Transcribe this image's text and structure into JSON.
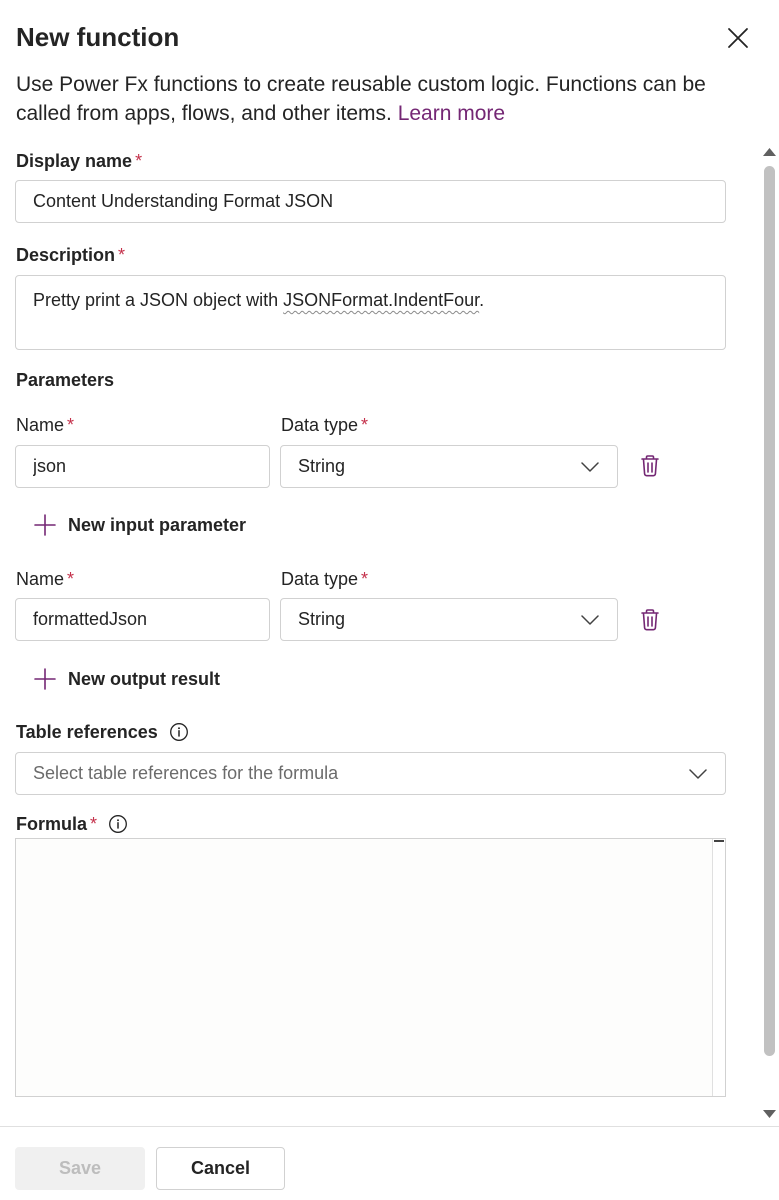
{
  "panel": {
    "title": "New function",
    "close_label": "Close",
    "intro_text": "Use Power Fx functions to create reusable custom logic. Functions can be called from apps, flows, and other items.",
    "learn_more": "Learn more"
  },
  "display_name": {
    "label": "Display name",
    "required_mark": "*",
    "value": "Content Understanding Format JSON"
  },
  "description": {
    "label": "Description",
    "required_mark": "*",
    "value_prefix": "Pretty print a JSON object with ",
    "value_flagged": "JSONFormat.IndentFour",
    "value_suffix": "."
  },
  "parameters": {
    "heading": "Parameters",
    "input": {
      "name_label": "Name",
      "name_required": "*",
      "name_value": "json",
      "type_label": "Data type",
      "type_required": "*",
      "type_value": "String"
    },
    "add_input_label": "New input parameter",
    "output": {
      "name_label": "Name",
      "name_required": "*",
      "name_value": "formattedJson",
      "type_label": "Data type",
      "type_required": "*",
      "type_value": "String"
    },
    "add_output_label": "New output result"
  },
  "table_references": {
    "label": "Table references",
    "placeholder": "Select table references for the formula"
  },
  "formula": {
    "label": "Formula",
    "required_mark": "*",
    "value": ""
  },
  "footer": {
    "save_label": "Save",
    "cancel_label": "Cancel"
  },
  "colors": {
    "accent": "#742774",
    "required": "#c4314b",
    "border": "#d1d1d1",
    "text": "#242424"
  }
}
